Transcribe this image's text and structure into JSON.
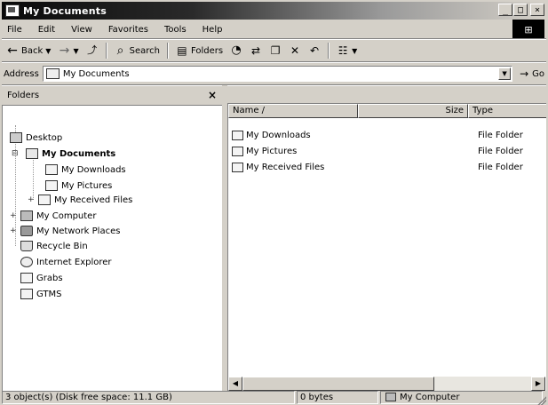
{
  "window": {
    "title": "My Documents"
  },
  "title_buttons": {
    "minimize": "_",
    "maximize": "□",
    "close": "×"
  },
  "menubar": [
    "File",
    "Edit",
    "View",
    "Favorites",
    "Tools",
    "Help"
  ],
  "toolbar": {
    "back": "Back",
    "search": "Search",
    "folders": "Folders"
  },
  "address": {
    "label": "Address",
    "value": "My Documents",
    "go": "Go"
  },
  "folders_pane": {
    "header": "Folders",
    "close": "×"
  },
  "tree": [
    {
      "label": "Desktop",
      "icon": "desktop-icon",
      "bold": false
    },
    {
      "label": "My Documents",
      "icon": "my-documents-icon",
      "bold": true,
      "expander": "⊟"
    },
    {
      "label": "My Downloads",
      "icon": "folder-icon",
      "bold": false
    },
    {
      "label": "My Pictures",
      "icon": "pictures-folder-icon",
      "bold": false
    },
    {
      "label": "My Received Files",
      "icon": "folder-icon",
      "bold": false,
      "expander": "+"
    },
    {
      "label": "My Computer",
      "icon": "computer-icon",
      "bold": false,
      "expander": "+"
    },
    {
      "label": "My Network Places",
      "icon": "network-icon",
      "bold": false,
      "expander": "+"
    },
    {
      "label": "Recycle Bin",
      "icon": "recycle-bin-icon",
      "bold": false
    },
    {
      "label": "Internet Explorer",
      "icon": "internet-explorer-icon",
      "bold": false
    },
    {
      "label": "Grabs",
      "icon": "folder-icon",
      "bold": false
    },
    {
      "label": "GTMS",
      "icon": "folder-icon",
      "bold": false
    }
  ],
  "columns": {
    "name": "Name /",
    "size": "Size",
    "type": "Type"
  },
  "files": [
    {
      "name": "My Downloads",
      "size": "",
      "type": "File Folder"
    },
    {
      "name": "My Pictures",
      "size": "",
      "type": "File Folder"
    },
    {
      "name": "My Received Files",
      "size": "",
      "type": "File Folder"
    }
  ],
  "status": {
    "objects": "3 object(s) (Disk free space: 11.1 GB)",
    "bytes": "0 bytes",
    "location": "My Computer"
  }
}
